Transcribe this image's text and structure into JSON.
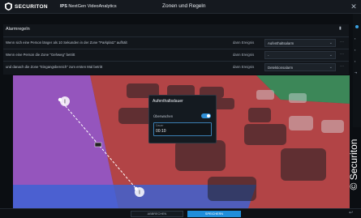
{
  "header": {
    "brand": "SECURITON",
    "product_bold": "IPS",
    "product_rest": "NextGen VideoAnalytics",
    "title": "Zonen und Regeln"
  },
  "rules": {
    "title": "Alarmregeln",
    "then_label": "dann Ereignis",
    "items": [
      {
        "text": "Wenn sich eine Person länger als 10 Sekunden in der Zone \"Parkplatz\" aufhält",
        "action": "Aufenthaltsalarm"
      },
      {
        "text": "Wenn eine Person die Zone \"Gehweg\" betritt",
        "action": "-"
      },
      {
        "text": "und danach die Zone \"Eingangsbereich\" zum ersten Mal betritt",
        "action": "Detektionsalarm"
      }
    ]
  },
  "scene": {
    "line_labels": [
      "I",
      "I"
    ]
  },
  "popup": {
    "title": "Aufenthaltsdauer",
    "toggle_label": "Überwachen",
    "field_label": "Dauer",
    "field_value": "00:10"
  },
  "footer": {
    "cancel_label": "ABBRECHEN",
    "save_label": "SPEICHERN"
  },
  "watermark": "© Securiton",
  "colors": {
    "accent": "#1f8edb",
    "zone_red": "#e04848",
    "zone_purple": "#b05ce0",
    "zone_blue": "#3b63d6",
    "zone_green": "#3ec46b"
  }
}
